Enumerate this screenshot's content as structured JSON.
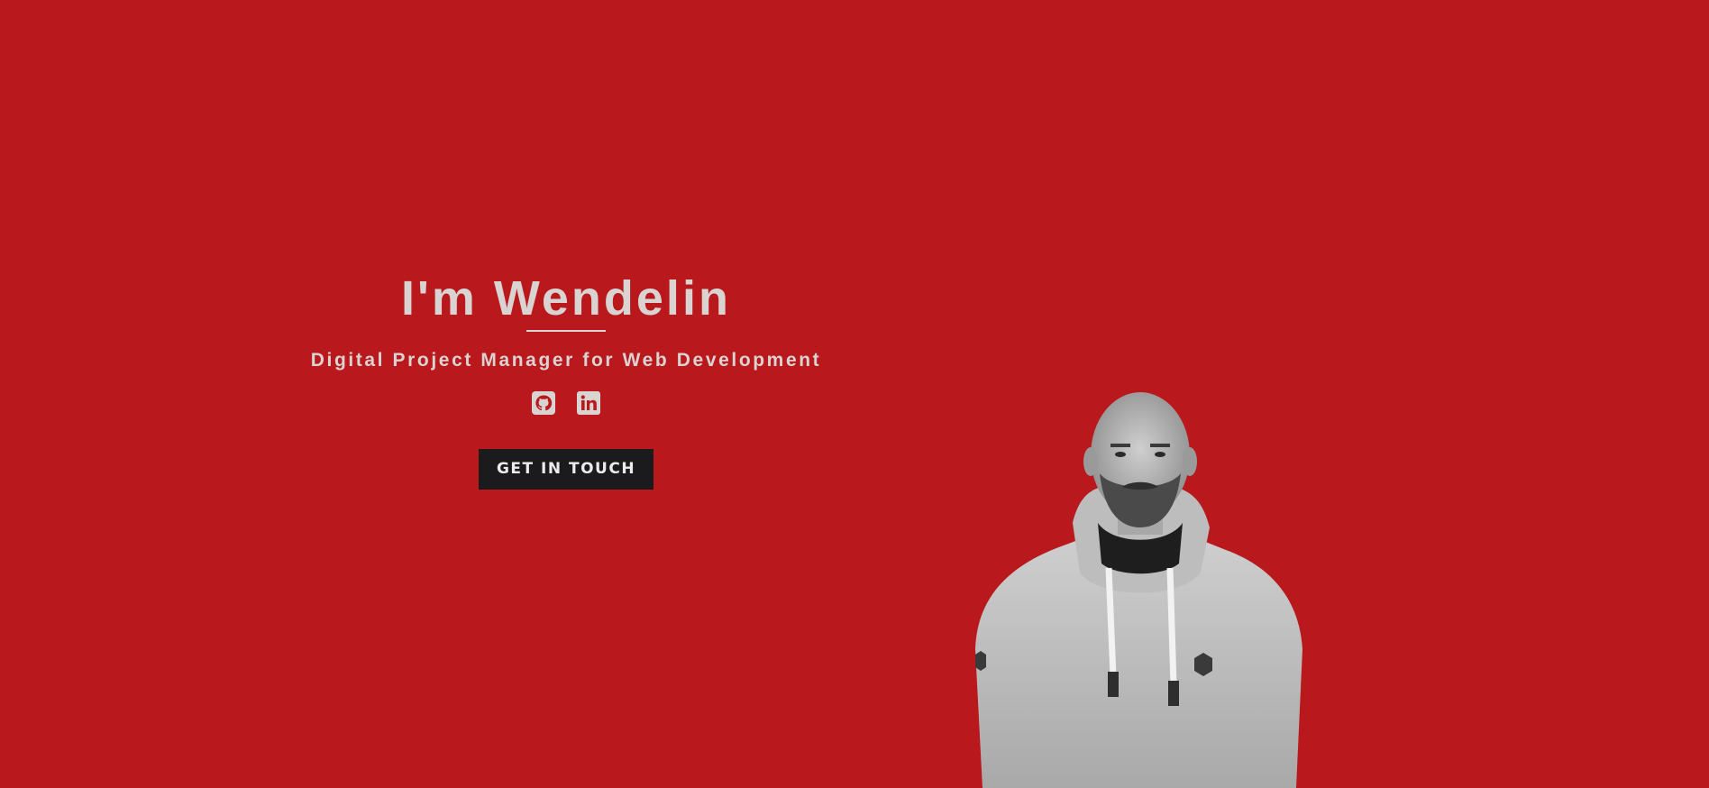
{
  "hero": {
    "title": "I'm Wendelin",
    "subtitle": "Digital Project Manager for Web Development",
    "social": [
      {
        "name": "github-icon"
      },
      {
        "name": "linkedin-icon"
      }
    ],
    "cta_label": "GET IN TOUCH"
  },
  "portrait": {
    "description_icon": "person-portrait"
  },
  "colors": {
    "background": "#b9181c",
    "text": "#d9d4d1",
    "button": "#1b1b1d"
  }
}
